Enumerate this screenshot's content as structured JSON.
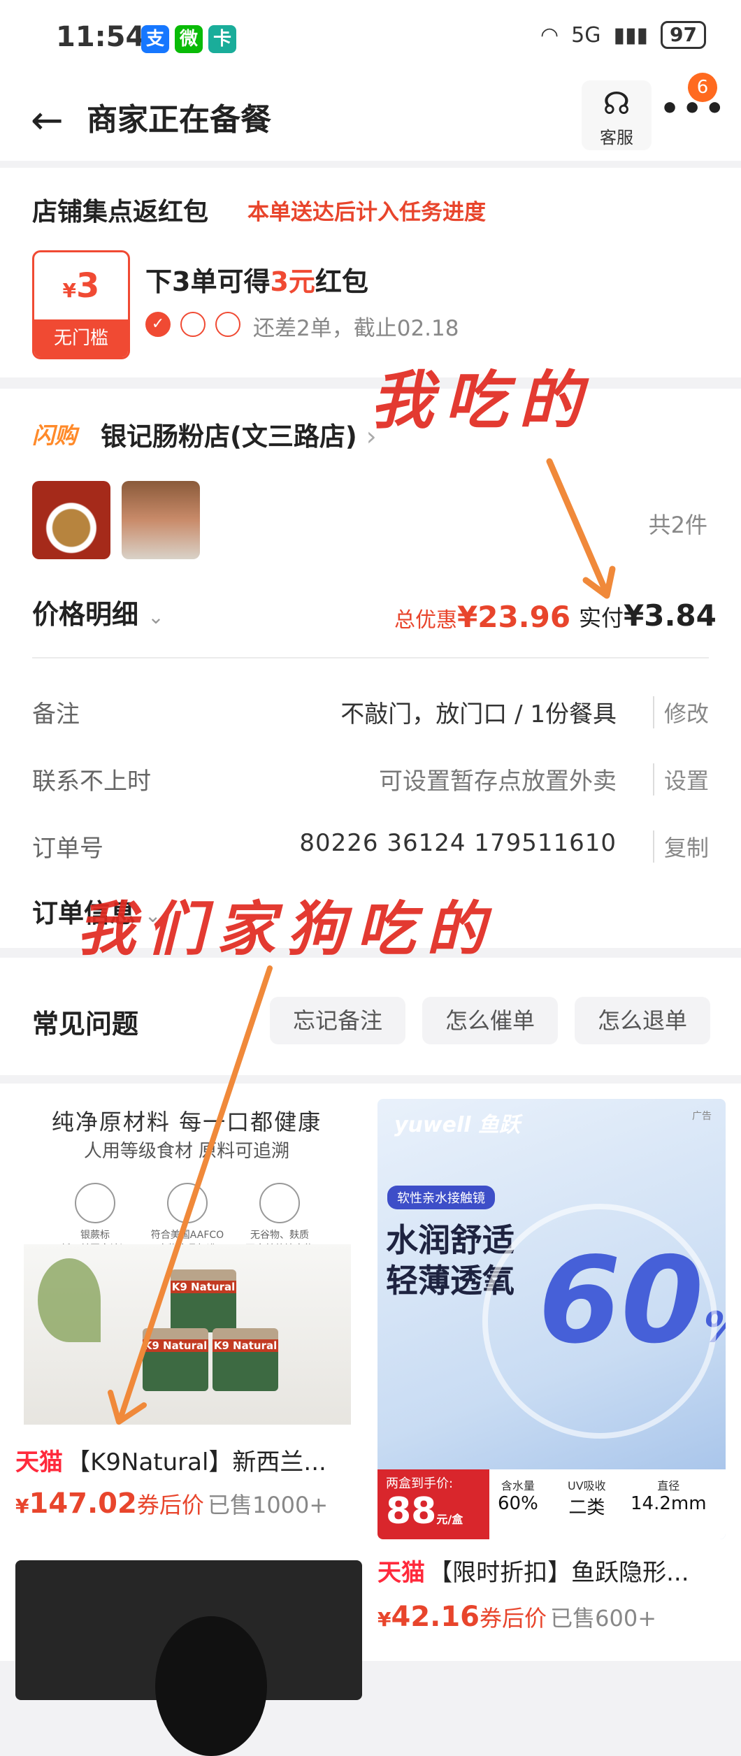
{
  "status_bar": {
    "time": "11:54",
    "apps": [
      "支",
      "微",
      "卡"
    ],
    "network": "5G",
    "battery": "97"
  },
  "header": {
    "title": "商家正在备餐",
    "service_label": "客服",
    "more_badge": "6"
  },
  "stamp_card": {
    "title": "店铺集点返红包",
    "subtitle": "本单送达后计入任务进度",
    "coupon_currency": "¥",
    "coupon_amount": "3",
    "coupon_label": "无门槛",
    "reward_prefix": "下3单可得",
    "reward_highlight": "3元",
    "reward_suffix": "红包",
    "progress_done_mark": "✓",
    "remaining_text": "还差2单，截止02.18"
  },
  "order": {
    "flash_label": "闪购",
    "store_name": "银记肠粉店(文三路店)",
    "item_count": "共2件",
    "price_detail_label": "价格明细",
    "discount_label": "总优惠",
    "discount_amount": "¥23.96",
    "paid_label": "实付",
    "paid_amount": "¥3.84",
    "rows": [
      {
        "label": "备注",
        "value": "不敲门，放门口 / 1份餐具",
        "action": "修改"
      },
      {
        "label": "联系不上时",
        "value": "可设置暂存点放置外卖",
        "action": "设置"
      },
      {
        "label": "订单号",
        "value": "80226 36124 179511610",
        "action": "复制"
      }
    ],
    "order_info_label": "订单信息"
  },
  "faq": {
    "title": "常见问题",
    "chips": [
      "忘记备注",
      "怎么催单",
      "怎么退单"
    ]
  },
  "products": [
    {
      "headline": "纯净原材料 每一口都健康",
      "subline": "人用等级食材 原料可追溯",
      "certs": [
        "银蕨标\n新西兰国家认证",
        "符合美国AAFCO\n宠物食品标准",
        "无谷物、麸质\n不含其他填充物"
      ],
      "can_brand": "K9 Natural",
      "store_tag": "天猫",
      "name": "【K9Natural】新西兰...",
      "currency": "¥",
      "price": "147.02",
      "coupon_text": "券后价",
      "sold": "已售1000+"
    },
    {
      "brand": "yuwell 鱼跃",
      "ad": "广告",
      "pill": "软性亲水接触镜",
      "line1": "水润舒适",
      "line2": "轻薄透氧",
      "big_percent": "60",
      "percent_sign": "%",
      "deal_label": "两盒到手价:",
      "deal_price": "88",
      "deal_unit": "元/盒",
      "specs": [
        {
          "k": "含水量",
          "v": "60%"
        },
        {
          "k": "UV吸收",
          "v": "二类"
        },
        {
          "k": "直径",
          "v": "14.2mm"
        }
      ],
      "store_tag": "天猫",
      "name": "【限时折扣】鱼跃隐形...",
      "currency": "¥",
      "price": "42.16",
      "coupon_text": "券后价",
      "sold": "已售600+"
    }
  ],
  "annotations": {
    "note1": "我吃的",
    "note2": "我们家狗吃的"
  },
  "colors": {
    "accent_red": "#e8452c",
    "arrow_orange": "#f0893a"
  }
}
